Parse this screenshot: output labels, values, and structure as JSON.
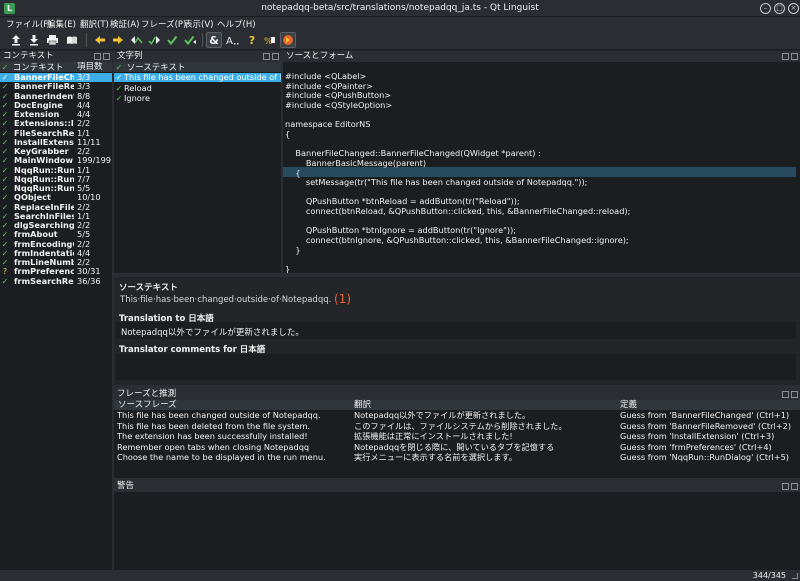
{
  "window": {
    "title": "notepadqq-beta/src/translations/notepadqq_ja.ts - Qt Linguist",
    "app_icon_glyph": "L"
  },
  "menu": [
    "ファイル(F)",
    "編集(E)",
    "翻訳(T)",
    "検証(A)",
    "フレーズ(P)",
    "表示(V)",
    "ヘルプ(H)"
  ],
  "toolbar": {
    "icons": [
      "open-icon",
      "save-icon",
      "print-icon",
      "phrasebook-icon",
      "prev-unfinished-icon",
      "next-unfinished-icon",
      "prev-icon",
      "next-icon",
      "done-next-icon",
      "done-icon",
      "accelerator-check-icon",
      "punctuation-check-icon",
      "phrase-check-icon",
      "placeholder-check-icon",
      "surrounding-whitespace-check-icon"
    ]
  },
  "context_pane": {
    "title": "コンテキスト",
    "col_context": "コンテキスト",
    "col_items": "項目数",
    "items": [
      {
        "name": "BannerFileChang...",
        "count": "3/3",
        "status": "done",
        "selected": true
      },
      {
        "name": "BannerFileRe...",
        "count": "3/3",
        "status": "done"
      },
      {
        "name": "BannerIndenta...",
        "count": "8/8",
        "status": "done"
      },
      {
        "name": "DocEngine",
        "count": "4/4",
        "status": "done"
      },
      {
        "name": "Extension",
        "count": "4/4",
        "status": "done"
      },
      {
        "name": "Extensions::Ins...",
        "count": "2/2",
        "status": "done"
      },
      {
        "name": "FileSearchResu...",
        "count": "1/1",
        "status": "done"
      },
      {
        "name": "InstallExtension",
        "count": "11/11",
        "status": "done"
      },
      {
        "name": "KeyGrabber",
        "count": "2/2",
        "status": "done"
      },
      {
        "name": "MainWindow",
        "count": "199/199",
        "status": "done"
      },
      {
        "name": "NqqRun::RunD...",
        "count": "1/1",
        "status": "done"
      },
      {
        "name": "NqqRun::RunD...",
        "count": "7/7",
        "status": "done"
      },
      {
        "name": "NqqRun::RunP...",
        "count": "5/5",
        "status": "done"
      },
      {
        "name": "QObject",
        "count": "10/10",
        "status": "done"
      },
      {
        "name": "ReplaceInFiles...",
        "count": "2/2",
        "status": "done"
      },
      {
        "name": "SearchInFiles...",
        "count": "1/1",
        "status": "done"
      },
      {
        "name": "dlgSearching",
        "count": "2/2",
        "status": "done"
      },
      {
        "name": "frmAbout",
        "count": "5/5",
        "status": "done"
      },
      {
        "name": "frmEncodingC...",
        "count": "2/2",
        "status": "done"
      },
      {
        "name": "frmIndentatio...",
        "count": "4/4",
        "status": "done"
      },
      {
        "name": "frmLineNumb...",
        "count": "2/2",
        "status": "done"
      },
      {
        "name": "frmPreferences",
        "count": "30/31",
        "status": "warn"
      },
      {
        "name": "frmSearchRepl...",
        "count": "36/36",
        "status": "done"
      }
    ]
  },
  "strings_pane": {
    "title": "文字列",
    "col_source": "ソーステキスト",
    "items": [
      {
        "text": "This file has been changed outside of Note...",
        "selected": true
      },
      {
        "text": "Reload"
      },
      {
        "text": "Ignore"
      }
    ]
  },
  "source_pane": {
    "title": "ソースとフォーム",
    "lines": [
      "#include <QLabel>",
      "#include <QPainter>",
      "#include <QPushButton>",
      "#include <QStyleOption>",
      "",
      "namespace EditorNS",
      "{",
      "",
      "    BannerFileChanged::BannerFileChanged(QWidget *parent) :",
      "        BannerBasicMessage(parent)",
      "    {",
      "        setMessage(tr(\"This file has been changed outside of Notepadqq.\"));",
      "",
      "        QPushButton *btnReload = addButton(tr(\"Reload\"));",
      "        connect(btnReload, &QPushButton::clicked, this, &BannerFileChanged::reload);",
      "",
      "        QPushButton *btnIgnore = addButton(tr(\"Ignore\"));",
      "        connect(btnIgnore, &QPushButton::clicked, this, &BannerFileChanged::ignore);",
      "    }",
      "",
      "}"
    ],
    "highlight_line": 11
  },
  "editor": {
    "source_label": "ソーステキスト",
    "source_text": "This·file·has·been·changed·outside·of·Notepadqq.",
    "marker": "(1)",
    "translation_label": "Translation to 日本語",
    "translation_text": "Notepadqq以外でファイルが更新されました。",
    "comments_label": "Translator comments for 日本語"
  },
  "phrases_pane": {
    "title": "フレーズと推測",
    "col_source": "ソースフレーズ",
    "col_translation": "翻訳",
    "col_definition": "定義",
    "rows": [
      {
        "source": "This file has been changed outside of Notepadqq.",
        "translation": "Notepadqq以外でファイルが更新されました。",
        "definition": "Guess from 'BannerFileChanged' (Ctrl+1)"
      },
      {
        "source": "This file has been deleted from the file system.",
        "translation": "このファイルは、ファイルシステムから削除されました。",
        "definition": "Guess from 'BannerFileRemoved' (Ctrl+2)"
      },
      {
        "source": "The extension has been successfully installed!",
        "translation": "拡張機能は正常にインストールされました!",
        "definition": "Guess from 'InstallExtension' (Ctrl+3)"
      },
      {
        "source": "Remember open tabs when closing Notepadqq",
        "translation": "Notepadqqを閉じる際に、開いているタブを記憶する",
        "definition": "Guess from 'frmPreferences' (Ctrl+4)"
      },
      {
        "source": "Choose the name to be displayed in the run menu.",
        "translation": "実行メニューに表示する名前を選択します。",
        "definition": "Guess from 'NqqRun::RunDialog' (Ctrl+5)"
      }
    ]
  },
  "warnings_pane": {
    "title": "警告"
  },
  "status": {
    "count": "344/345"
  },
  "colors": {
    "accent": "#3daee9",
    "marker": "#e8622f",
    "done": "#5ec55e",
    "warn": "#e5c84e"
  }
}
